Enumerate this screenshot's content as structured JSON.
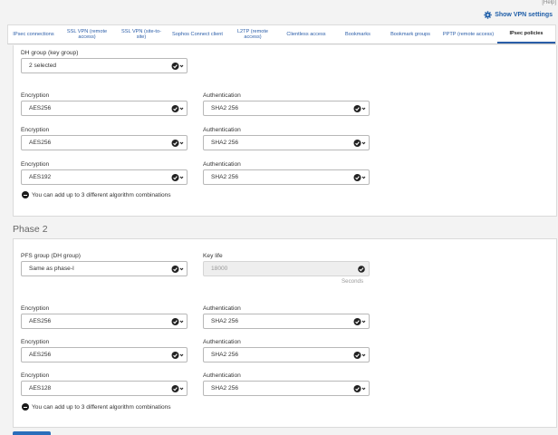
{
  "top_help": "[Help]",
  "show_vpn_settings": "Show VPN settings",
  "tabs": [
    {
      "label": "IPsec connections"
    },
    {
      "label": "SSL VPN (remote access)"
    },
    {
      "label": "SSL VPN (site-to-site)"
    },
    {
      "label": "Sophos Connect client"
    },
    {
      "label": "L2TP (remote access)"
    },
    {
      "label": "Clientless access"
    },
    {
      "label": "Bookmarks"
    },
    {
      "label": "Bookmark groups"
    },
    {
      "label": "PPTP (remote access)"
    },
    {
      "label": "IPsec policies"
    }
  ],
  "active_tab": "IPsec policies",
  "phase1": {
    "dh_group_label": "DH group (key group)",
    "dh_group_value": "2 selected",
    "rows": [
      {
        "enc_label": "Encryption",
        "enc_value": "AES256",
        "auth_label": "Authentication",
        "auth_value": "SHA2 256"
      },
      {
        "enc_label": "Encryption",
        "enc_value": "AES256",
        "auth_label": "Authentication",
        "auth_value": "SHA2 256"
      },
      {
        "enc_label": "Encryption",
        "enc_value": "AES192",
        "auth_label": "Authentication",
        "auth_value": "SHA2 256"
      }
    ],
    "note": "You can add up to 3 different algorithm combinations"
  },
  "phase2": {
    "title": "Phase 2",
    "pfs_label": "PFS group (DH group)",
    "pfs_value": "Same as phase-I",
    "key_life_label": "Key life",
    "key_life_value": "18000",
    "key_life_unit": "Seconds",
    "rows": [
      {
        "enc_label": "Encryption",
        "enc_value": "AES256",
        "auth_label": "Authentication",
        "auth_value": "SHA2 256"
      },
      {
        "enc_label": "Encryption",
        "enc_value": "AES256",
        "auth_label": "Authentication",
        "auth_value": "SHA2 256"
      },
      {
        "enc_label": "Encryption",
        "enc_value": "AES128",
        "auth_label": "Authentication",
        "auth_value": "SHA2 256"
      }
    ],
    "note": "You can add up to 3 different algorithm combinations"
  },
  "colors": {
    "accent": "#2a5da8",
    "panel_bg": "#ffffff",
    "page_bg": "#f3f3f3"
  }
}
